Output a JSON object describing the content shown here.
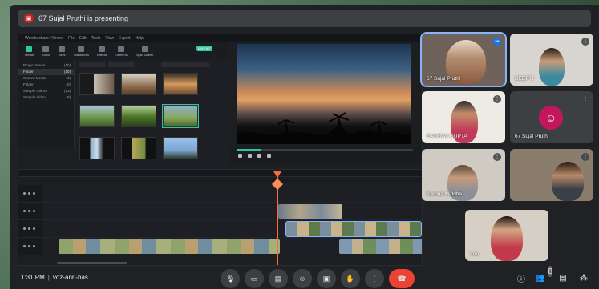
{
  "meeting": {
    "presenting_text": "67 Sujal Pruthi is presenting",
    "time": "1:31 PM",
    "separator": "|",
    "meeting_code": "voz-anrl-has",
    "people_count": "8",
    "accent": "#1a73e8",
    "end_call_color": "#ea4335"
  },
  "filmora": {
    "menu": [
      "Wondershare Filmora",
      "File",
      "Edit",
      "Tools",
      "View",
      "Export",
      "Help"
    ],
    "tools": [
      "Media",
      "Audio",
      "Titles",
      "Transitions",
      "Effects",
      "Elements",
      "Split Screen"
    ],
    "export_label": "EXPORT",
    "project_items": [
      {
        "label": "Project Media",
        "count": "(10)"
      },
      {
        "label": "Folder",
        "count": "(10)"
      },
      {
        "label": "Shared Media",
        "count": "(0)"
      },
      {
        "label": "Folder",
        "count": "(0)"
      },
      {
        "label": "Sample Colors",
        "count": "(13)"
      },
      {
        "label": "Sample Video",
        "count": "(9)"
      }
    ]
  },
  "tiles": [
    {
      "name": "67 Sujal Pruthi"
    },
    {
      "name": "DEEPTI"
    },
    {
      "name": "GAURAV GUPTA"
    },
    {
      "name": "67 Sujal Pruthi"
    },
    {
      "name": "Karuna Middha"
    },
    {
      "name": ""
    },
    {
      "name": "You"
    }
  ]
}
